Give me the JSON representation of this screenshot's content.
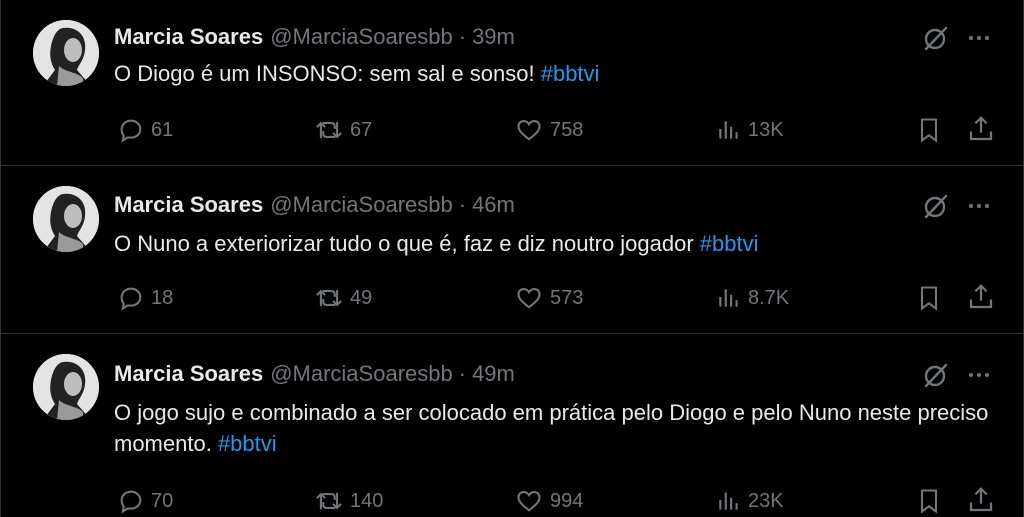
{
  "tweets": [
    {
      "name": "Marcia Soares",
      "handle": "@MarciaSoaresbb",
      "separator": "·",
      "time": "39m",
      "text": "O Diogo é um INSONSO: sem sal e sonso! ",
      "hashtag": "#bbtvi",
      "replies": "61",
      "retweets": "67",
      "likes": "758",
      "views": "13K"
    },
    {
      "name": "Marcia Soares",
      "handle": "@MarciaSoaresbb",
      "separator": "·",
      "time": "46m",
      "text": "O Nuno a exteriorizar tudo o que é, faz e diz noutro jogador ",
      "hashtag": "#bbtvi",
      "replies": "18",
      "retweets": "49",
      "likes": "573",
      "views": "8.7K"
    },
    {
      "name": "Marcia Soares",
      "handle": "@MarciaSoaresbb",
      "separator": "·",
      "time": "49m",
      "text": "O jogo sujo e combinado a ser colocado em prática pelo Diogo e pelo Nuno neste preciso momento.  ",
      "hashtag": "#bbtvi",
      "replies": "70",
      "retweets": "140",
      "likes": "994",
      "views": "23K"
    }
  ],
  "colors": {
    "background": "#000000",
    "text": "#e7e9ea",
    "muted": "#71767b",
    "hashtag": "#1d9bf0",
    "divider": "#2f3336"
  },
  "icons": {
    "reply": "reply-icon",
    "retweet": "retweet-icon",
    "like": "like-icon",
    "views": "views-icon",
    "bookmark": "bookmark-icon",
    "share": "share-icon",
    "grok": "grok-icon",
    "more": "more-icon"
  }
}
